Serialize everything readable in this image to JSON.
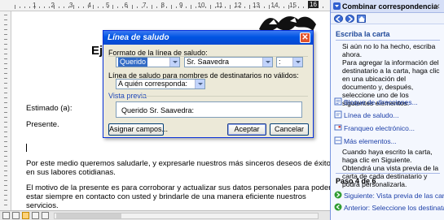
{
  "document": {
    "title": "Ej",
    "greeting": "Estimado (a):",
    "present": "Presente.",
    "paragraph1_line1": "Por este medio queremos saludarle, y expresarle nuestros más sinceros deseos de éxito",
    "paragraph1_line2": "en sus labores cotidianas.",
    "paragraph2_line1": "El motivo de la presente es para corroborar y actualizar sus datos personales para poder",
    "paragraph2_line2": "estar siempre en contacto con usted y brindarle de una manera eficiente nuestros",
    "paragraph2_line3": "servicios.",
    "ruler_numbers": [
      "1",
      "2",
      "3",
      "4",
      "5",
      "6",
      "7",
      "8",
      "9",
      "10",
      "11",
      "12",
      "13",
      "14",
      "15"
    ],
    "ruler_badge": "16"
  },
  "dialog": {
    "title": "Línea de saludo",
    "format_label": "Formato de la línea de saludo:",
    "salutation_value": "Querido",
    "name_format_value": "Sr. Saavedra",
    "punctuation_value": ":",
    "invalid_label": "Línea de saludo para nombres de destinatarios no válidos:",
    "invalid_value": "A quién corresponda:",
    "preview_label": "Vista previa",
    "preview_text": "Querido Sr. Saavedra:",
    "match_fields_button": "Asignar campos...",
    "ok_button": "Aceptar",
    "cancel_button": "Cancelar"
  },
  "task_pane": {
    "title": "Combinar correspondencia",
    "section_heading": "Escriba la carta",
    "intro_text": "Si aún no lo ha hecho, escriba ahora.",
    "add_info_text": "Para agregar la información del destinatario a la carta, haga clic en una ubicación del documento y, después, seleccione uno de los siguientes elementos.",
    "links": [
      "Bloque de direcciones...",
      "Línea de saludo...",
      "Franqueo electrónico...",
      "Más elementos..."
    ],
    "after_text": "Cuando haya escrito la carta, haga clic en Siguiente. Obtendrá una vista previa de la carta de cada destinatario y podrá personalizarla.",
    "step_heading": "Paso 4 de 6",
    "next_link": "Siguiente: Vista previa de las cartas",
    "prev_link": "Anterior: Seleccione los destinatarios"
  },
  "colors": {
    "dialog_title_blue": "#0054e3",
    "link_blue": "#1c3fa8",
    "pane_heading": "#214a9a",
    "selection": "#316ac5"
  }
}
